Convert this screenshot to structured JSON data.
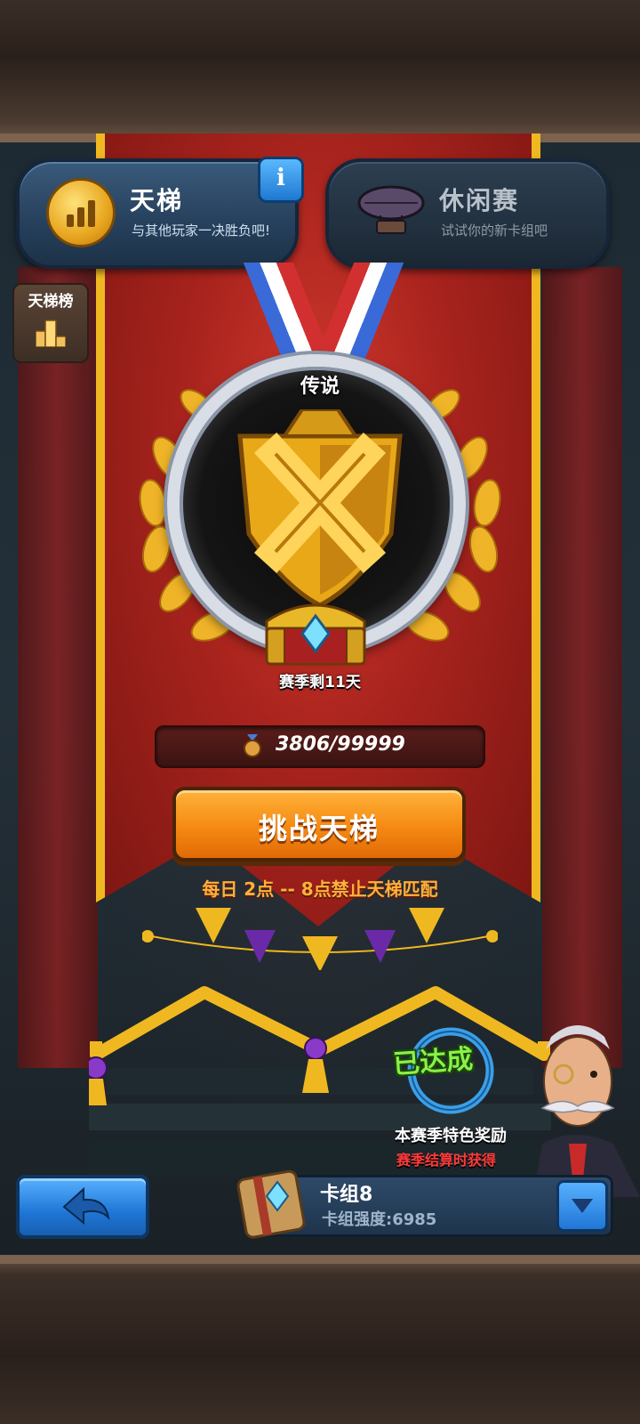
{
  "modes": {
    "ladder": {
      "title": "天梯",
      "subtitle": "与其他玩家一决胜负吧!",
      "icon": "ladder-medal-icon",
      "info_label": "i"
    },
    "casual": {
      "title": "休闲赛",
      "subtitle": "试试你的新卡组吧",
      "icon": "airship-icon"
    }
  },
  "leaderboard": {
    "label": "天梯榜",
    "icon": "podium-icon"
  },
  "rank": {
    "name": "传说",
    "season_remaining": "赛季剩11天"
  },
  "points": {
    "text": "3806/99999",
    "current": 3806,
    "max": 99999,
    "icon": "points-medal-icon"
  },
  "challenge": {
    "label": "挑战天梯",
    "note": "每日 2点 -- 8点禁止天梯匹配"
  },
  "reward": {
    "status": "已达成",
    "title": "本赛季特色奖励",
    "subtitle": "赛季结算时获得"
  },
  "deck": {
    "name": "卡组8",
    "strength": "卡组强度:6985",
    "icon": "deck-book-icon"
  },
  "navigation": {
    "back_icon": "back-arrow-icon",
    "dropdown_icon": "chevron-down-icon"
  },
  "colors": {
    "banner_red": "#a8231d",
    "banner_gold": "#f0b820",
    "button_orange": "#f58a12",
    "button_blue": "#1f76d6",
    "achieved_green": "#8bf04a",
    "reward_red": "#ff3a3a"
  }
}
